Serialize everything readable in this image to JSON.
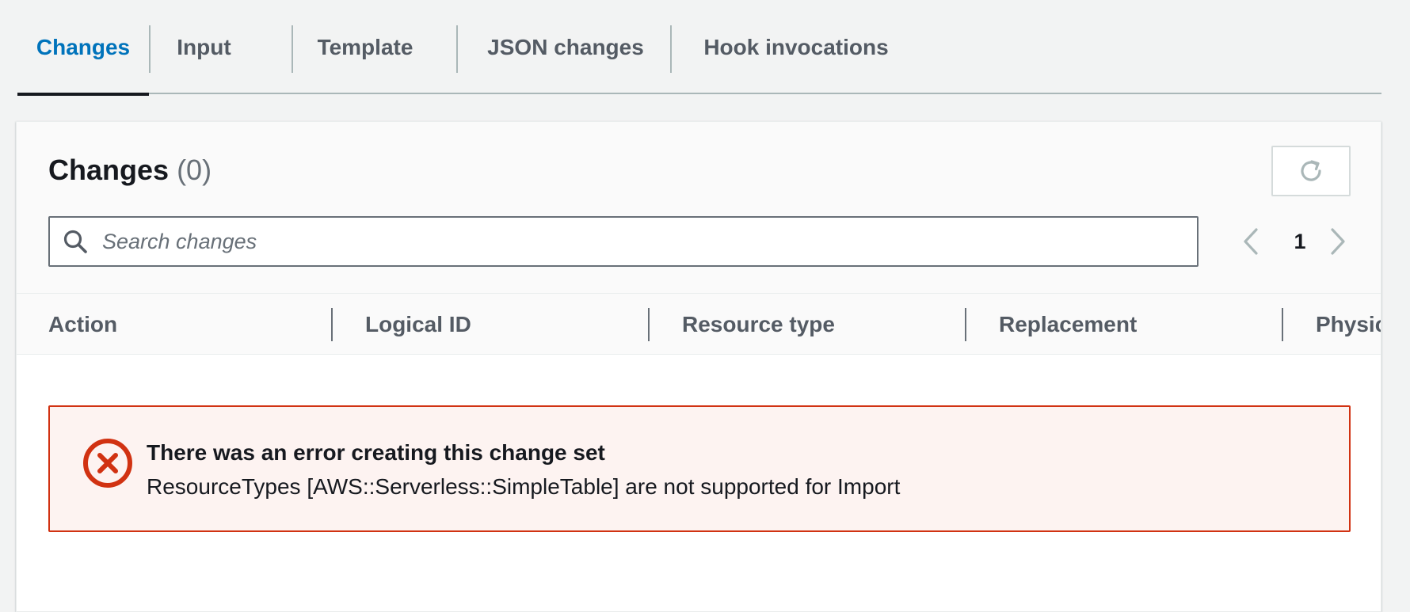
{
  "tabs": [
    {
      "label": "Changes",
      "active": true
    },
    {
      "label": "Input",
      "active": false
    },
    {
      "label": "Template",
      "active": false
    },
    {
      "label": "JSON changes",
      "active": false
    },
    {
      "label": "Hook invocations",
      "active": false
    }
  ],
  "panel": {
    "title": "Changes",
    "count": "(0)",
    "refresh_icon": "refresh-icon"
  },
  "search": {
    "placeholder": "Search changes",
    "value": "",
    "icon": "search-icon"
  },
  "pagination": {
    "current_page": "1",
    "prev_icon": "chevron-left-icon",
    "next_icon": "chevron-right-icon"
  },
  "table": {
    "columns": [
      "Action",
      "Logical ID",
      "Resource type",
      "Replacement",
      "Physic"
    ]
  },
  "alert": {
    "type": "error",
    "icon": "error-icon",
    "title": "There was an error creating this change set",
    "message": "ResourceTypes [AWS::Serverless::SimpleTable] are not supported for Import"
  },
  "colors": {
    "accent": "#0073bb",
    "error": "#d13212",
    "error_bg": "#fdf3f1",
    "background": "#f2f3f3"
  }
}
